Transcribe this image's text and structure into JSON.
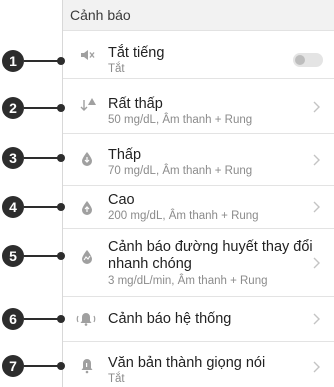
{
  "header": {
    "title": "Cảnh báo"
  },
  "items": [
    {
      "number": "1",
      "icon": "speaker-muted-icon",
      "title": "Tắt tiếng",
      "subtitle": "Tắt",
      "control": "toggle",
      "toggle_on": false
    },
    {
      "number": "2",
      "icon": "urgent-low-alert-icon",
      "title": "Rất thấp",
      "subtitle": "50 mg/dL, Âm thanh + Rung",
      "control": "chevron"
    },
    {
      "number": "3",
      "icon": "low-drop-icon",
      "title": "Thấp",
      "subtitle": "70 mg/dL, Âm thanh + Rung",
      "control": "chevron"
    },
    {
      "number": "4",
      "icon": "high-drop-icon",
      "title": "Cao",
      "subtitle": "200 mg/dL, Âm thanh + Rung",
      "control": "chevron"
    },
    {
      "number": "5",
      "icon": "rate-change-drop-icon",
      "title_line1": "Cảnh báo đường huyết thay đổi",
      "title_line2": "nhanh chóng",
      "subtitle": "3 mg/dL/min, Âm thanh + Rung",
      "control": "chevron"
    },
    {
      "number": "6",
      "icon": "system-bell-icon",
      "title": "Cảnh báo hệ thống",
      "control": "chevron"
    },
    {
      "number": "7",
      "icon": "text-to-speech-icon",
      "title": "Văn bản thành giọng nói",
      "subtitle": "Tắt",
      "control": "chevron"
    }
  ],
  "colors": {
    "callout": "#2d2d2d",
    "divider": "#e3e3e3",
    "subtitle": "#8b8b8b",
    "icon": "#9a9a9a"
  }
}
